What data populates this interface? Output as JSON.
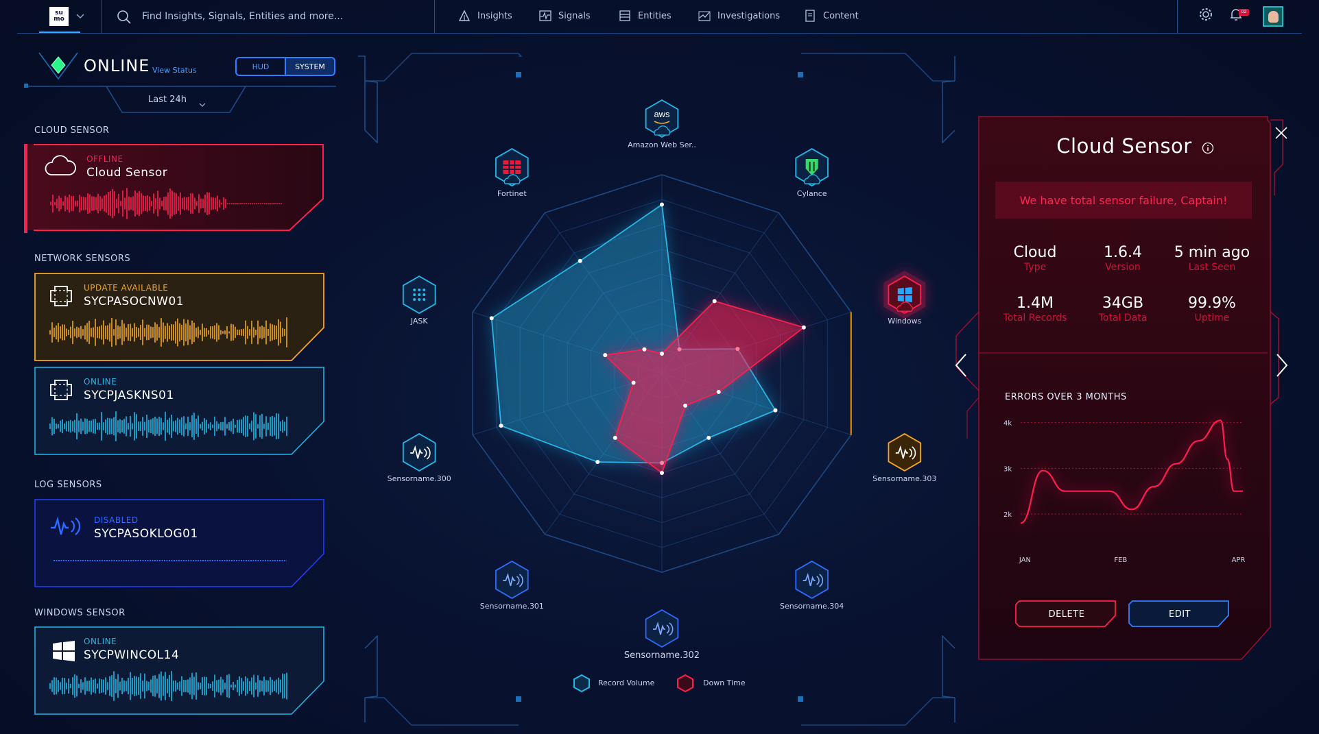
{
  "topbar": {
    "logo_text": "su mo",
    "search_placeholder": "Find Insights, Signals, Entities and more...",
    "nav": [
      {
        "label": "Insights",
        "icon": "insights-icon"
      },
      {
        "label": "Signals",
        "icon": "signals-icon"
      },
      {
        "label": "Entities",
        "icon": "entities-icon"
      },
      {
        "label": "Investigations",
        "icon": "investigations-icon"
      },
      {
        "label": "Content",
        "icon": "content-icon"
      }
    ],
    "notification_count": "02"
  },
  "left_panel": {
    "status": "ONLINE",
    "view_status": "View Status",
    "toggle": {
      "hud": "HUD",
      "system": "SYSTEM",
      "selected": "SYSTEM"
    },
    "time_range": "Last 24h",
    "sections": [
      {
        "label": "CLOUD SENSOR",
        "cards": [
          {
            "status": "OFFLINE",
            "name": "Cloud Sensor",
            "icon": "cloud-icon",
            "color": "#ff1f4f"
          }
        ]
      },
      {
        "label": "NETWORK SENSORS",
        "cards": [
          {
            "status": "UPDATE AVAILABLE",
            "name": "SYCPASOCNW01",
            "icon": "network-sensor-icon",
            "color": "#f5a623"
          },
          {
            "status": "ONLINE",
            "name": "SYCPJASKNS01",
            "icon": "network-sensor-icon",
            "color": "#22b8e8"
          }
        ]
      },
      {
        "label": "LOG SENSORS",
        "cards": [
          {
            "status": "DISABLED",
            "name": "SYCPASOKLOG01",
            "icon": "log-sensor-icon",
            "color": "#2440ff"
          }
        ]
      },
      {
        "label": "WINDOWS SENSOR",
        "cards": [
          {
            "status": "ONLINE",
            "name": "SYCPWINCOL14",
            "icon": "windows-icon",
            "color": "#22b8e8"
          }
        ]
      }
    ]
  },
  "radar": {
    "nodes": [
      {
        "label": "Amazon Web Ser..",
        "icon": "aws-icon",
        "state": "normal"
      },
      {
        "label": "Cylance",
        "icon": "cylance-icon",
        "state": "normal"
      },
      {
        "label": "Windows",
        "icon": "windows-icon",
        "state": "alert"
      },
      {
        "label": "Sensorname.303",
        "icon": "sensor-icon",
        "state": "warning"
      },
      {
        "label": "Sensorname.304",
        "icon": "sensor-icon",
        "state": "normal"
      },
      {
        "label": "Sensorname.302",
        "icon": "sensor-icon",
        "state": "normal"
      },
      {
        "label": "Sensorname.301",
        "icon": "sensor-icon",
        "state": "normal"
      },
      {
        "label": "Sensorname.300",
        "icon": "sensor-icon",
        "state": "normal"
      },
      {
        "label": "JASK",
        "icon": "jask-icon",
        "state": "normal"
      },
      {
        "label": "Fortinet",
        "icon": "fortinet-icon",
        "state": "normal"
      }
    ],
    "series": [
      {
        "name": "Record Volume",
        "color": "#22b8e8",
        "values": [
          0.85,
          0.15,
          0.4,
          0.6,
          0.4,
          0.45,
          0.55,
          0.85,
          0.9,
          0.7
        ]
      },
      {
        "name": "Down Time",
        "color": "#ff1f4f",
        "values": [
          0.1,
          0.45,
          0.75,
          0.3,
          0.2,
          0.5,
          0.4,
          0.15,
          0.3,
          0.15
        ]
      }
    ]
  },
  "detail_panel": {
    "title": "Cloud Sensor",
    "alert": "We have total sensor failure, Captain!",
    "stats": [
      {
        "value": "Cloud",
        "label": "Type"
      },
      {
        "value": "1.6.4",
        "label": "Version"
      },
      {
        "value": "5 min ago",
        "label": "Last Seen"
      },
      {
        "value": "1.4M",
        "label": "Total Records"
      },
      {
        "value": "34GB",
        "label": "Total Data"
      },
      {
        "value": "99.9%",
        "label": "Uptime"
      }
    ],
    "chart_title": "ERRORS OVER 3 MONTHS",
    "delete_label": "DELETE",
    "edit_label": "EDIT"
  },
  "chart_data": {
    "type": "line",
    "title": "ERRORS OVER 3 MONTHS",
    "xlabel": "",
    "ylabel": "",
    "x_ticks": [
      "JAN",
      "FEB",
      "APR"
    ],
    "y_ticks": [
      "2k",
      "3k",
      "4k"
    ],
    "ylim": [
      1700,
      4100
    ],
    "grid": true,
    "series": [
      {
        "color": "#ff1f4f",
        "x": [
          0,
          0.1,
          0.2,
          0.3,
          0.4,
          0.5,
          0.6,
          0.7,
          0.8,
          0.9,
          0.93,
          0.96,
          1.0
        ],
        "y": [
          1800,
          2950,
          2500,
          2500,
          2500,
          2100,
          2600,
          3100,
          3600,
          4050,
          3200,
          2500,
          2500
        ]
      }
    ]
  },
  "colors": {
    "accent_blue": "#22b8e8",
    "alert_red": "#ff1f4f",
    "warning_orange": "#f5a623",
    "disabled_blue": "#2440ff"
  }
}
